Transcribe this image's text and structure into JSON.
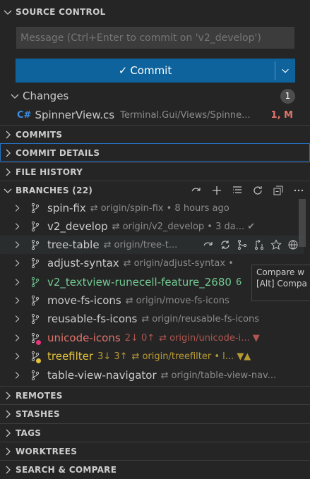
{
  "source_control": {
    "title": "SOURCE CONTROL",
    "message_placeholder": "Message (Ctrl+Enter to commit on 'v2_develop')",
    "commit_label": "Commit",
    "changes_label": "Changes",
    "changes_count": "1",
    "file": {
      "icon": "C#",
      "name": "SpinnerView.cs",
      "path": "Terminal.Gui/Views/Spinne...",
      "status": "1, M"
    }
  },
  "sections": {
    "commits": "COMMITS",
    "commit_details": "COMMIT DETAILS",
    "file_history": "FILE HISTORY",
    "branches": "BRANCHES (22)",
    "remotes": "REMOTES",
    "stashes": "STASHES",
    "tags": "TAGS",
    "worktrees": "WORKTREES",
    "search_compare": "SEARCH & COMPARE"
  },
  "branches": [
    {
      "name": "spin-fix",
      "meta": "origin/spin-fix  •  8 hours ago"
    },
    {
      "name": "v2_develop",
      "meta": "origin/v2_develop  •  3 da... ✔"
    },
    {
      "name": "tree-table",
      "meta": "origin/tree-t..."
    },
    {
      "name": "adjust-syntax",
      "meta": "origin/adjust-syntax  •"
    },
    {
      "name": "v2_textview-runecell-feature_2680",
      "meta": "6"
    },
    {
      "name": "move-fs-icons",
      "meta": "origin/move-fs-icons"
    },
    {
      "name": "reusable-fs-icons",
      "meta": "origin/reusable-fs-icons"
    },
    {
      "name": "unicode-icons",
      "counts": "2↓ 0↑",
      "meta": "origin/unicode-i...  ▼"
    },
    {
      "name": "treefilter",
      "counts": "3↓ 3↑",
      "meta": "origin/treefilter  •  l...  ▼▲"
    },
    {
      "name": "table-view-navigator",
      "meta": "origin/table-view-nav..."
    }
  ],
  "tooltip": {
    "line1": "Compare w",
    "line2": "[Alt] Compa"
  },
  "colors": {
    "accent": "#0e639c",
    "modified": "#e2746b",
    "green": "#73c991",
    "red": "#e8357a",
    "yellow": "#e2c13b"
  }
}
